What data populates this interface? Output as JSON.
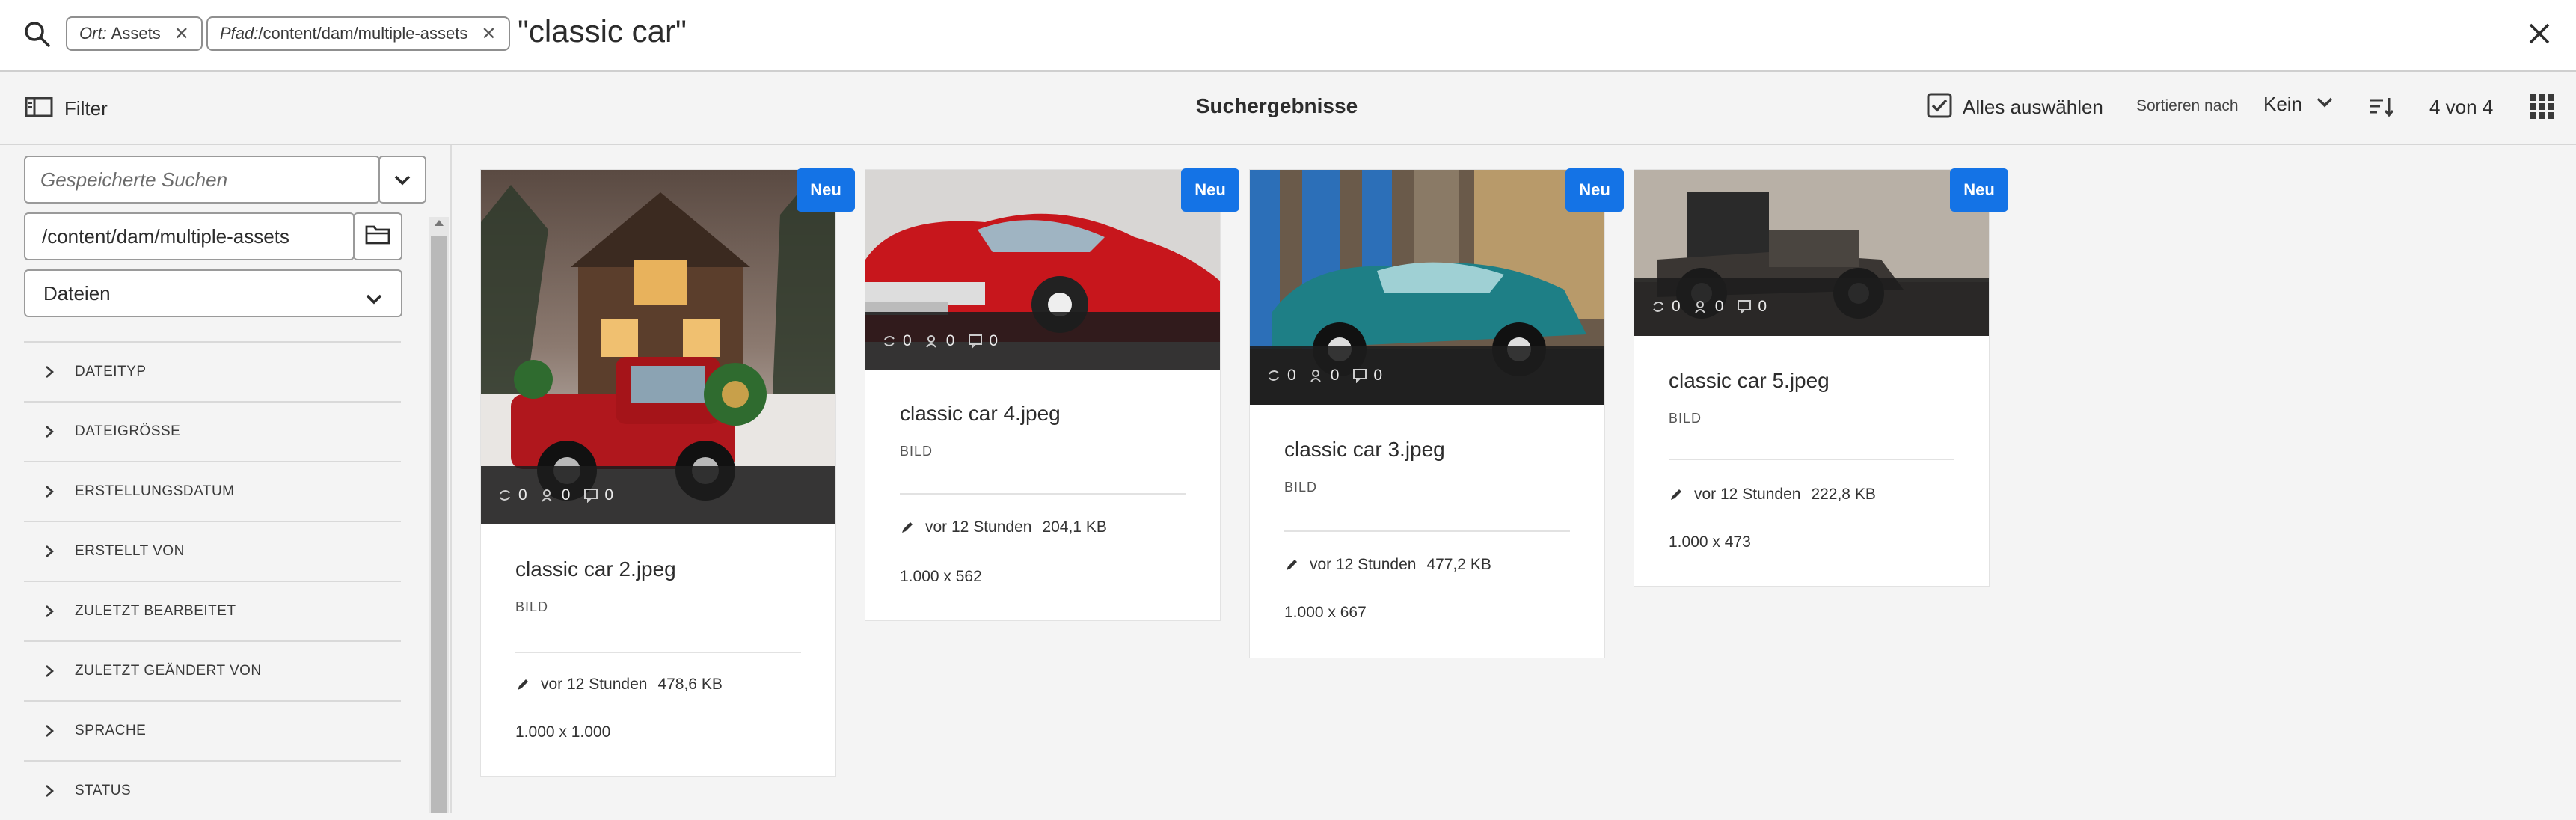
{
  "search": {
    "tags": [
      {
        "key": "Ort:",
        "value": "Assets"
      },
      {
        "key": "Pfad:",
        "value": "/content/dam/multiple-assets"
      }
    ],
    "query": "\"classic car\""
  },
  "actionbar": {
    "filter_label": "Filter",
    "title": "Suchergebnisse",
    "select_all_label": "Alles auswählen",
    "sort_label": "Sortieren nach",
    "sort_value": "Kein",
    "count_label": "4 von 4"
  },
  "rail": {
    "saved_search_placeholder": "Gespeicherte Suchen",
    "path_value": "/content/dam/multiple-assets",
    "type_value": "Dateien",
    "facets": [
      "DATEITYP",
      "DATEIGRÖSSE",
      "ERSTELLUNGSDATUM",
      "ERSTELLT VON",
      "ZULETZT BEARBEITET",
      "ZULETZT GEÄNDERT VON",
      "SPRACHE",
      "STATUS"
    ]
  },
  "cards": [
    {
      "name": "classic car 2.jpeg",
      "type": "BILD",
      "badge": "Neu",
      "modified": "vor 12 Stunden",
      "size": "478,6 KB",
      "dims": "1.000 x 1.000",
      "stats": [
        "0",
        "0",
        "0"
      ],
      "thumb": "red-truck-barn"
    },
    {
      "name": "classic car 4.jpeg",
      "type": "BILD",
      "badge": "Neu",
      "modified": "vor 12 Stunden",
      "size": "204,1 KB",
      "dims": "1.000 x 562",
      "stats": [
        "0",
        "0",
        "0"
      ],
      "thumb": "red-cadillac"
    },
    {
      "name": "classic car 3.jpeg",
      "type": "BILD",
      "badge": "Neu",
      "modified": "vor 12 Stunden",
      "size": "477,2 KB",
      "dims": "1.000 x 667",
      "stats": [
        "0",
        "0",
        "0"
      ],
      "thumb": "teal-sedan-street"
    },
    {
      "name": "classic car 5.jpeg",
      "type": "BILD",
      "badge": "Neu",
      "modified": "vor 12 Stunden",
      "size": "222,8 KB",
      "dims": "1.000 x 473",
      "stats": [
        "0",
        "0",
        "0"
      ],
      "thumb": "vintage-black-car"
    }
  ],
  "colors": {
    "accent": "#1473e6",
    "statbar": "#1c1c1c"
  }
}
